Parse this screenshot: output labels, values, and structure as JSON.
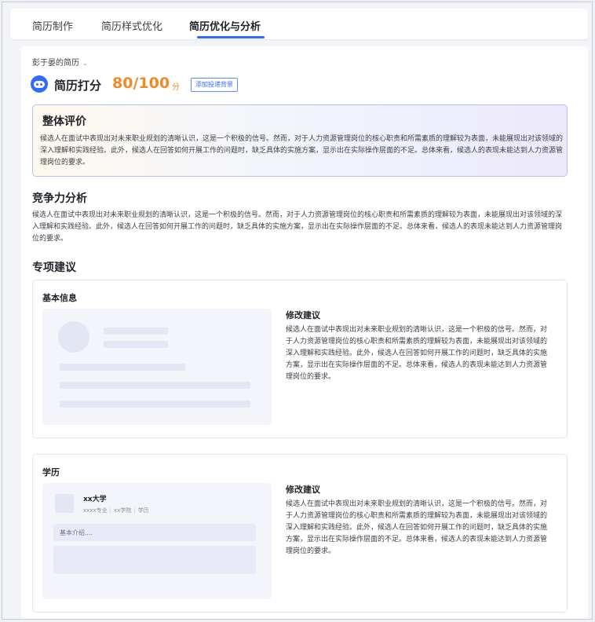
{
  "tabs": [
    {
      "label": "简历制作",
      "active": false
    },
    {
      "label": "简历样式优化",
      "active": false
    },
    {
      "label": "简历优化与分析",
      "active": true
    }
  ],
  "resume_owner": "彭于晏的简历",
  "score": {
    "label": "简历打分",
    "value": "80/100",
    "unit": "分",
    "add_background_button": "添加投递背景"
  },
  "overall": {
    "title": "整体评价",
    "text": "候选人在面试中表现出对未来职业规划的清晰认识，这是一个积极的信号。然而，对于人力资源管理岗位的核心职责和所需素质的理解较为表面，未能展现出对该领域的深入理解和实践经验。此外，候选人在回答如何开展工作的问题时，缺乏具体的实施方案，显示出在实际操作层面的不足。总体来看，候选人的表现未能达到人力资源管理岗位的要求。"
  },
  "competitiveness": {
    "title": "竞争力分析",
    "text": "候选人在面试中表现出对未来职业规划的清晰认识，这是一个积极的信号。然而，对于人力资源管理岗位的核心职责和所需素质的理解较为表面，未能展现出对该领域的深入理解和实践经验。此外，候选人在回答如何开展工作的问题时，缺乏具体的实施方案，显示出在实际操作层面的不足。总体来看，候选人的表现未能达到人力资源管理岗位的要求。"
  },
  "specific": {
    "title": "专项建议",
    "cards": [
      {
        "title": "基本信息",
        "advice_title": "修改建议",
        "advice_text": "候选人在面试中表现出对未来职业规划的清晰认识，这是一个积极的信号。然而，对于人力资源管理岗位的核心职责和所需素质的理解较为表面，未能展现出对该领域的深入理解和实践经验。此外，候选人在回答如何开展工作的问题时，缺乏具体的实施方案，显示出在实际操作层面的不足。总体来看，候选人的表现未能达到人力资源管理岗位的要求。"
      },
      {
        "title": "学历",
        "advice_title": "修改建议",
        "advice_text": "候选人在面试中表现出对未来职业规划的清晰认识，这是一个积极的信号。然而，对于人力资源管理岗位的核心职责和所需素质的理解较为表面，未能展现出对该领域的深入理解和实践经验。此外，候选人在回答如何开展工作的问题时，缺乏具体的实施方案，显示出在实际操作层面的不足。总体来看，候选人的表现未能达到人力资源管理岗位的要求。",
        "preview": {
          "school": "xx大学",
          "major": "xxxx专业",
          "college": "xx学院",
          "degree": "学历",
          "intro_placeholder": "基本介绍...."
        }
      }
    ]
  },
  "icons": {
    "owner_dropdown": "chevron-down-icon",
    "score": "robot-icon"
  },
  "colors": {
    "accent": "#2f6bff",
    "score": "#f08a24"
  }
}
